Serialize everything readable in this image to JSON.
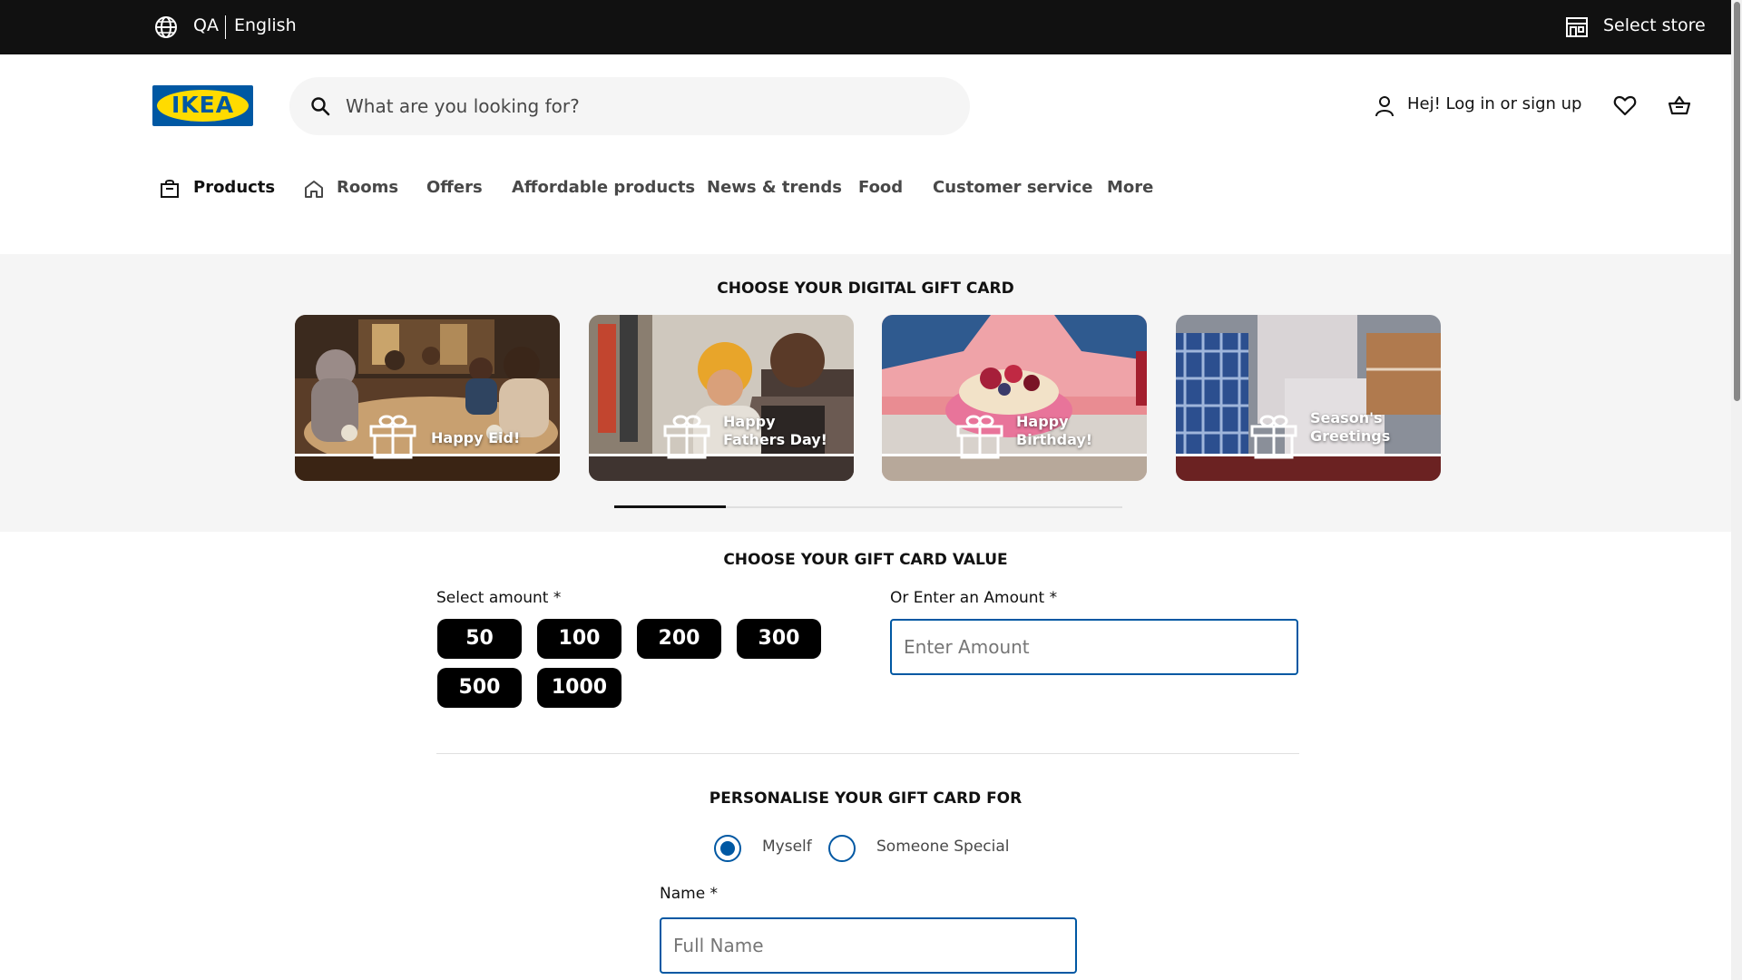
{
  "topbar": {
    "country": "QA",
    "language": "English",
    "select_store": "Select store",
    "globe_icon": "globe-icon",
    "store_icon": "store-icon"
  },
  "header": {
    "logo_text": "IKEA",
    "search_placeholder": "What are you looking for?",
    "search_value": "",
    "login_label": "Hej! Log in or sign up",
    "icons": [
      "search-icon",
      "user-icon",
      "heart-icon",
      "shopping-basket-icon"
    ]
  },
  "nav": {
    "items": [
      {
        "label": "Products",
        "icon": "shopping-bag-icon",
        "active": true
      },
      {
        "label": "Rooms",
        "icon": "home-icon",
        "active": false
      },
      {
        "label": "Offers",
        "active": false
      },
      {
        "label": "Affordable products",
        "active": false
      },
      {
        "label": "News & trends",
        "active": false
      },
      {
        "label": "Food",
        "active": false
      },
      {
        "label": "Customer service",
        "active": false
      },
      {
        "label": "More",
        "active": false
      }
    ]
  },
  "gift_cards": {
    "title": "CHOOSE YOUR DIGITAL GIFT CARD",
    "cards": [
      {
        "label_line1": "Happy Eid!",
        "label_line2": ""
      },
      {
        "label_line1": "Happy",
        "label_line2": "Fathers Day!"
      },
      {
        "label_line1": "Happy",
        "label_line2": "Birthday!"
      },
      {
        "label_line1": "Season's",
        "label_line2": "Greetings"
      }
    ],
    "carousel_progress": 0.22
  },
  "value": {
    "title": "CHOOSE YOUR GIFT CARD VALUE",
    "select_label": "Select amount *",
    "amounts": [
      "50",
      "100",
      "200",
      "300",
      "500",
      "1000"
    ],
    "enter_label": "Or Enter an Amount *",
    "enter_placeholder": "Enter Amount",
    "enter_value": ""
  },
  "personalise": {
    "title": "PERSONALISE YOUR GIFT CARD FOR",
    "options": [
      {
        "label": "Myself",
        "selected": true
      },
      {
        "label": "Someone Special",
        "selected": false
      }
    ],
    "name_label": "Name *",
    "name_placeholder": "Full Name",
    "name_value": ""
  },
  "colors": {
    "topbar": "#111111",
    "brand_blue": "#0058a3",
    "brand_yellow": "#ffdb00",
    "band": "#f5f5f5"
  }
}
